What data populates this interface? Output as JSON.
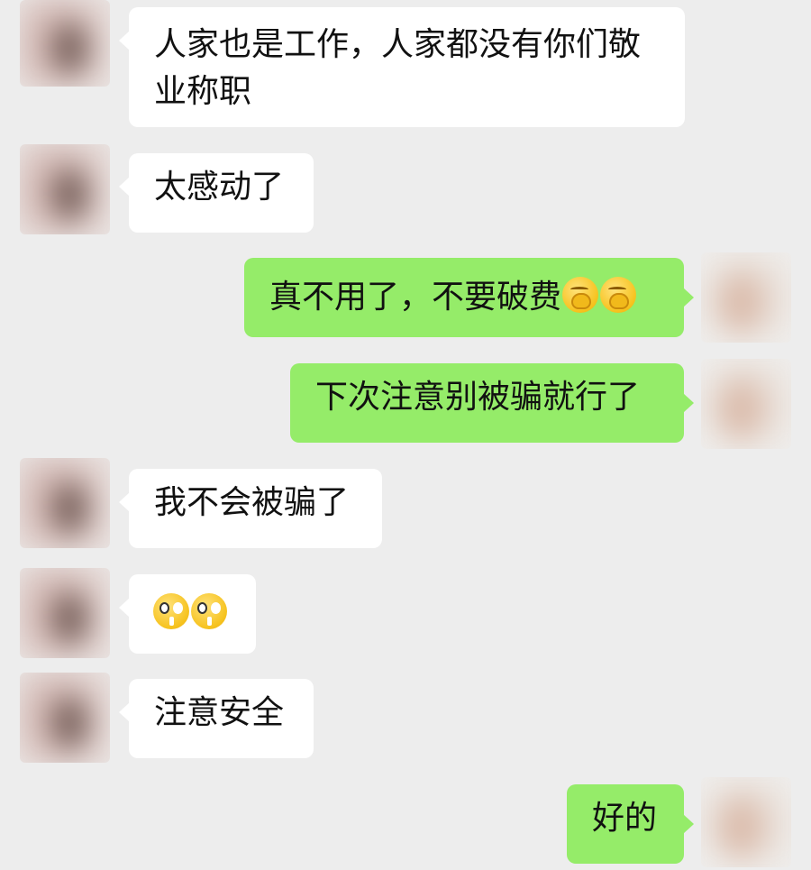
{
  "messages": [
    {
      "side": "left",
      "text": "人家也是工作，人家都没有你们敬业称职"
    },
    {
      "side": "left",
      "text": "太感动了"
    },
    {
      "side": "right",
      "text": "真不用了，不要破费",
      "emoji": [
        "hand-over-mouth-icon",
        "hand-over-mouth-icon"
      ]
    },
    {
      "side": "right",
      "text": "下次注意别被骗就行了"
    },
    {
      "side": "left",
      "text": "我不会被骗了"
    },
    {
      "side": "left",
      "text": "",
      "emoji": [
        "teary-eyes-icon",
        "teary-eyes-icon"
      ]
    },
    {
      "side": "left",
      "text": "注意安全"
    },
    {
      "side": "right",
      "text": "好的"
    }
  ],
  "colors": {
    "background": "#ededed",
    "incoming_bubble": "#ffffff",
    "outgoing_bubble": "#95ec69"
  }
}
